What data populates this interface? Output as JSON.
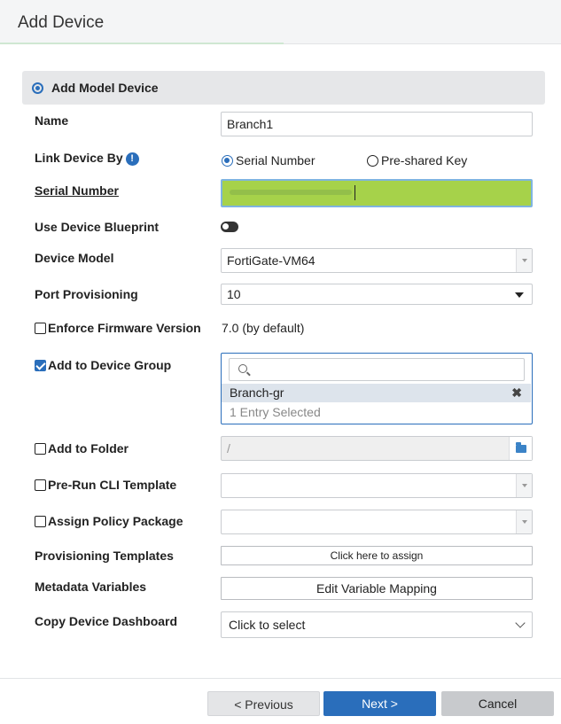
{
  "header": {
    "title": "Add Device"
  },
  "section": {
    "label": "Add Model Device"
  },
  "form": {
    "name": {
      "label": "Name",
      "value": "Branch1"
    },
    "link_device_by": {
      "label": "Link Device By",
      "info_icon": "info-icon",
      "options": [
        "Serial Number",
        "Pre-shared Key"
      ],
      "selected": "Serial Number"
    },
    "serial_number": {
      "label": "Serial Number",
      "value": ""
    },
    "use_blueprint": {
      "label": "Use Device Blueprint",
      "enabled": false
    },
    "device_model": {
      "label": "Device Model",
      "value": "FortiGate-VM64"
    },
    "port_provisioning": {
      "label": "Port Provisioning",
      "value": "10"
    },
    "enforce_firmware": {
      "label": "Enforce Firmware Version",
      "checked": false,
      "value": "7.0 (by default)"
    },
    "device_group": {
      "label": "Add to Device Group",
      "checked": true,
      "search_placeholder": "",
      "selected_item": "Branch-gr",
      "count_text": "1 Entry Selected"
    },
    "folder": {
      "label": "Add to Folder",
      "checked": false,
      "value": "/"
    },
    "pre_run_cli": {
      "label": "Pre-Run CLI Template",
      "checked": false,
      "value": ""
    },
    "policy_package": {
      "label": "Assign Policy Package",
      "checked": false,
      "value": ""
    },
    "provisioning_templates": {
      "label": "Provisioning Templates",
      "button": "Click here to assign"
    },
    "metadata_variables": {
      "label": "Metadata Variables",
      "button": "Edit Variable Mapping"
    },
    "copy_dashboard": {
      "label": "Copy Device Dashboard",
      "value": "Click to select"
    }
  },
  "footer": {
    "previous": "< Previous",
    "next": "Next >",
    "cancel": "Cancel"
  },
  "colors": {
    "accent": "#2a6ebb",
    "serial_highlight": "#a6d24a"
  }
}
